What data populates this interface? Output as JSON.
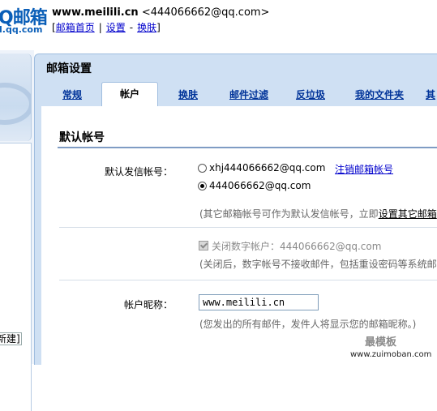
{
  "header": {
    "logo_main": "Q邮箱",
    "logo_sub": "l.qq.com",
    "account_name": "www.meilili.cn",
    "account_email": "<444066662@qq.com>",
    "links": [
      "邮箱首页",
      "设置",
      "换肤"
    ],
    "separators": [
      "|",
      "-"
    ]
  },
  "sidebar": {
    "new_folder_label": "新建]"
  },
  "panel": {
    "title": "邮箱设置",
    "tabs": [
      "常规",
      "帐户",
      "换肤",
      "邮件过滤",
      "反垃圾",
      "我的文件夹",
      "其"
    ],
    "active_tab": "帐户"
  },
  "content": {
    "section_title": "默认帐号",
    "default_sender_label": "默认发信帐号：",
    "sender_options": [
      {
        "label": "xhj444066662@qq.com",
        "selected": false,
        "link": "注销邮箱帐号"
      },
      {
        "label": "444066662@qq.com",
        "selected": true
      }
    ],
    "sender_hint": "(其它邮箱帐号可作为默认发信帐号，立即",
    "sender_hint_link": "设置其它邮箱",
    "digital_account_label": "关闭数字帐户：444066662@qq.com",
    "digital_account_checked": true,
    "digital_account_hint": "(关闭后，数字帐号不接收邮件，包括重设密码等系统邮件",
    "nickname_label": "帐户昵称：",
    "nickname_value": "www.meilili.cn",
    "nickname_hint": "(您发出的所有邮件，发件人将显示您的邮箱昵称。)"
  },
  "watermark": {
    "top": "最模板",
    "bottom": "www.zuimoban.com"
  },
  "colors": {
    "brand_blue": "#0b5fb8",
    "link_blue": "#003399",
    "panel_bg": "#cfe0f3",
    "border_blue": "#9fbddf"
  }
}
